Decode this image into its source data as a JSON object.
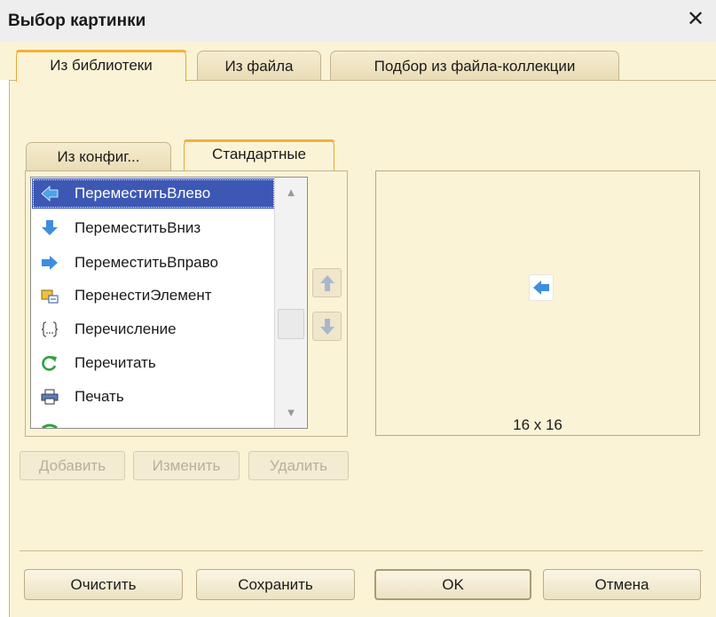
{
  "window": {
    "title": "Выбор картинки"
  },
  "tabs": [
    {
      "label": "Из библиотеки",
      "active": true
    },
    {
      "label": "Из файла",
      "active": false
    },
    {
      "label": "Подбор из файла-коллекции",
      "active": false
    }
  ],
  "inner_tabs": [
    {
      "label": "Из конфиг...",
      "active": false
    },
    {
      "label": "Стандартные",
      "active": true
    }
  ],
  "list": {
    "items": [
      {
        "label": "ПереместитьВлево",
        "icon": "arrow-left-icon",
        "selected": true
      },
      {
        "label": "ПереместитьВниз",
        "icon": "arrow-down-icon",
        "selected": false
      },
      {
        "label": "ПереместитьВправо",
        "icon": "arrow-right-icon",
        "selected": false
      },
      {
        "label": "ПеренестиЭлемент",
        "icon": "transfer-icon",
        "selected": false
      },
      {
        "label": "Перечисление",
        "icon": "enum-braces-icon",
        "selected": false
      },
      {
        "label": "Перечитать",
        "icon": "reload-icon",
        "selected": false
      },
      {
        "label": "Печать",
        "icon": "printer-icon",
        "selected": false
      }
    ]
  },
  "list_actions": {
    "add": "Добавить",
    "edit": "Изменить",
    "delete": "Удалить"
  },
  "preview": {
    "size": "16 x 16",
    "icon": "arrow-left-icon"
  },
  "footer": {
    "clear": "Очистить",
    "save": "Сохранить",
    "ok": "OK",
    "cancel": "Отмена"
  },
  "colors": {
    "background": "#fbf3d6",
    "selection": "#3d58b4",
    "accent": "#f2b23c",
    "icon_blue": "#4a90e2"
  }
}
